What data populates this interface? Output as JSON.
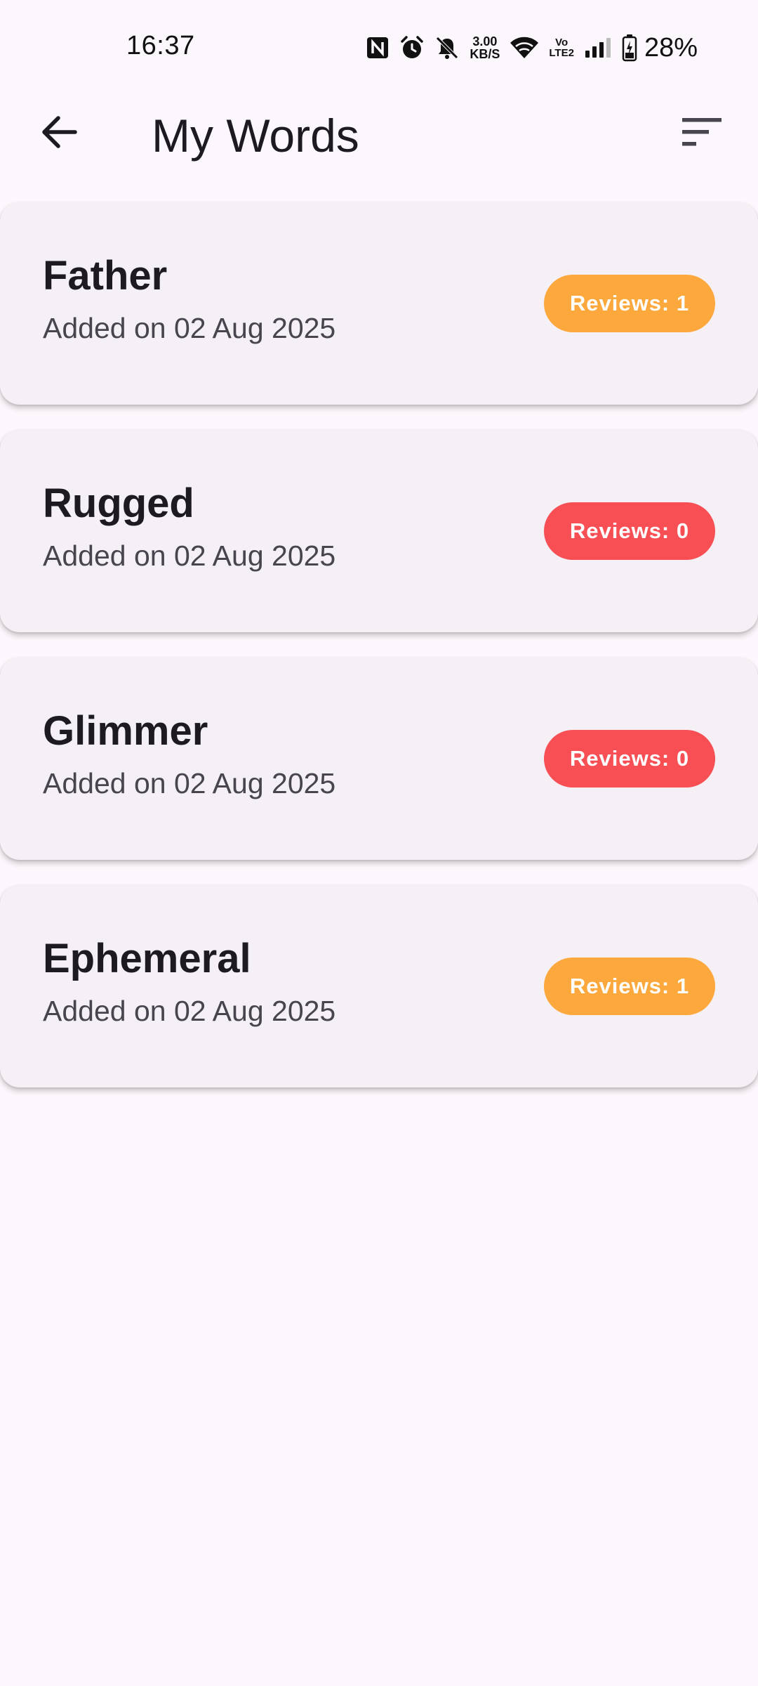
{
  "status_bar": {
    "time": "16:37",
    "net_speed_value": "3.00",
    "net_speed_unit": "KB/S",
    "volte_top": "Vo",
    "volte_bottom": "LTE2",
    "battery_percent": "28%",
    "icons": [
      "nfc-icon",
      "alarm-icon",
      "mute-bell-icon",
      "wifi-icon",
      "signal-icon",
      "battery-charging-icon"
    ]
  },
  "app_bar": {
    "title": "My Words",
    "back_icon": "arrow-left-icon",
    "sort_icon": "sort-icon"
  },
  "colors": {
    "background": "#fcf7fc",
    "card": "#f4f0f5",
    "badge_reviewed": "#fda83c",
    "badge_unreviewed": "#f84f55"
  },
  "words": [
    {
      "word": "Father",
      "added": "Added on 02 Aug 2025",
      "reviews": "Reviews: 1",
      "status": "reviewed"
    },
    {
      "word": "Rugged",
      "added": "Added on 02 Aug 2025",
      "reviews": "Reviews: 0",
      "status": "unreviewed"
    },
    {
      "word": "Glimmer",
      "added": "Added on 02 Aug 2025",
      "reviews": "Reviews: 0",
      "status": "unreviewed"
    },
    {
      "word": "Ephemeral",
      "added": "Added on 02 Aug 2025",
      "reviews": "Reviews: 1",
      "status": "reviewed"
    }
  ]
}
